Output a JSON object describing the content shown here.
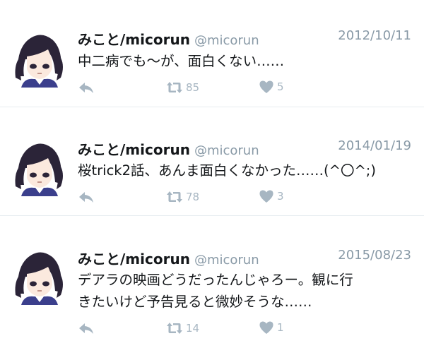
{
  "tweets": [
    {
      "display_name": "みこと/micorun",
      "handle": "@micorun",
      "date": "2012/10/11",
      "lines": [
        "中二病でも〜が、面白くない……"
      ],
      "retweets": "85",
      "likes": "5",
      "icons": [
        "avatar-image",
        "reply-icon",
        "retweet-icon",
        "heart-icon"
      ]
    },
    {
      "display_name": "みこと/micorun",
      "handle": "@micorun",
      "date": "2014/01/19",
      "lines": [
        "桜trick2話、あんま面白くなかった……(^〇^;)"
      ],
      "retweets": "78",
      "likes": "3",
      "icons": [
        "avatar-image",
        "reply-icon",
        "retweet-icon",
        "heart-icon"
      ]
    },
    {
      "display_name": "みこと/micorun",
      "handle": "@micorun",
      "date": "2015/08/23",
      "lines": [
        "デアラの映画どうだったんじゃろー。観に行",
        "きたいけど予告見ると微妙そうな……"
      ],
      "retweets": "14",
      "likes": "1",
      "icons": [
        "avatar-image",
        "reply-icon",
        "retweet-icon",
        "heart-icon"
      ]
    }
  ],
  "colors": {
    "text": "#14171a",
    "muted": "#8899a6",
    "icon": "#a7b6c2",
    "divider": "#e6ecf0",
    "avatar_hair": "#2b2438",
    "avatar_cloth": "#3b3f8c"
  }
}
